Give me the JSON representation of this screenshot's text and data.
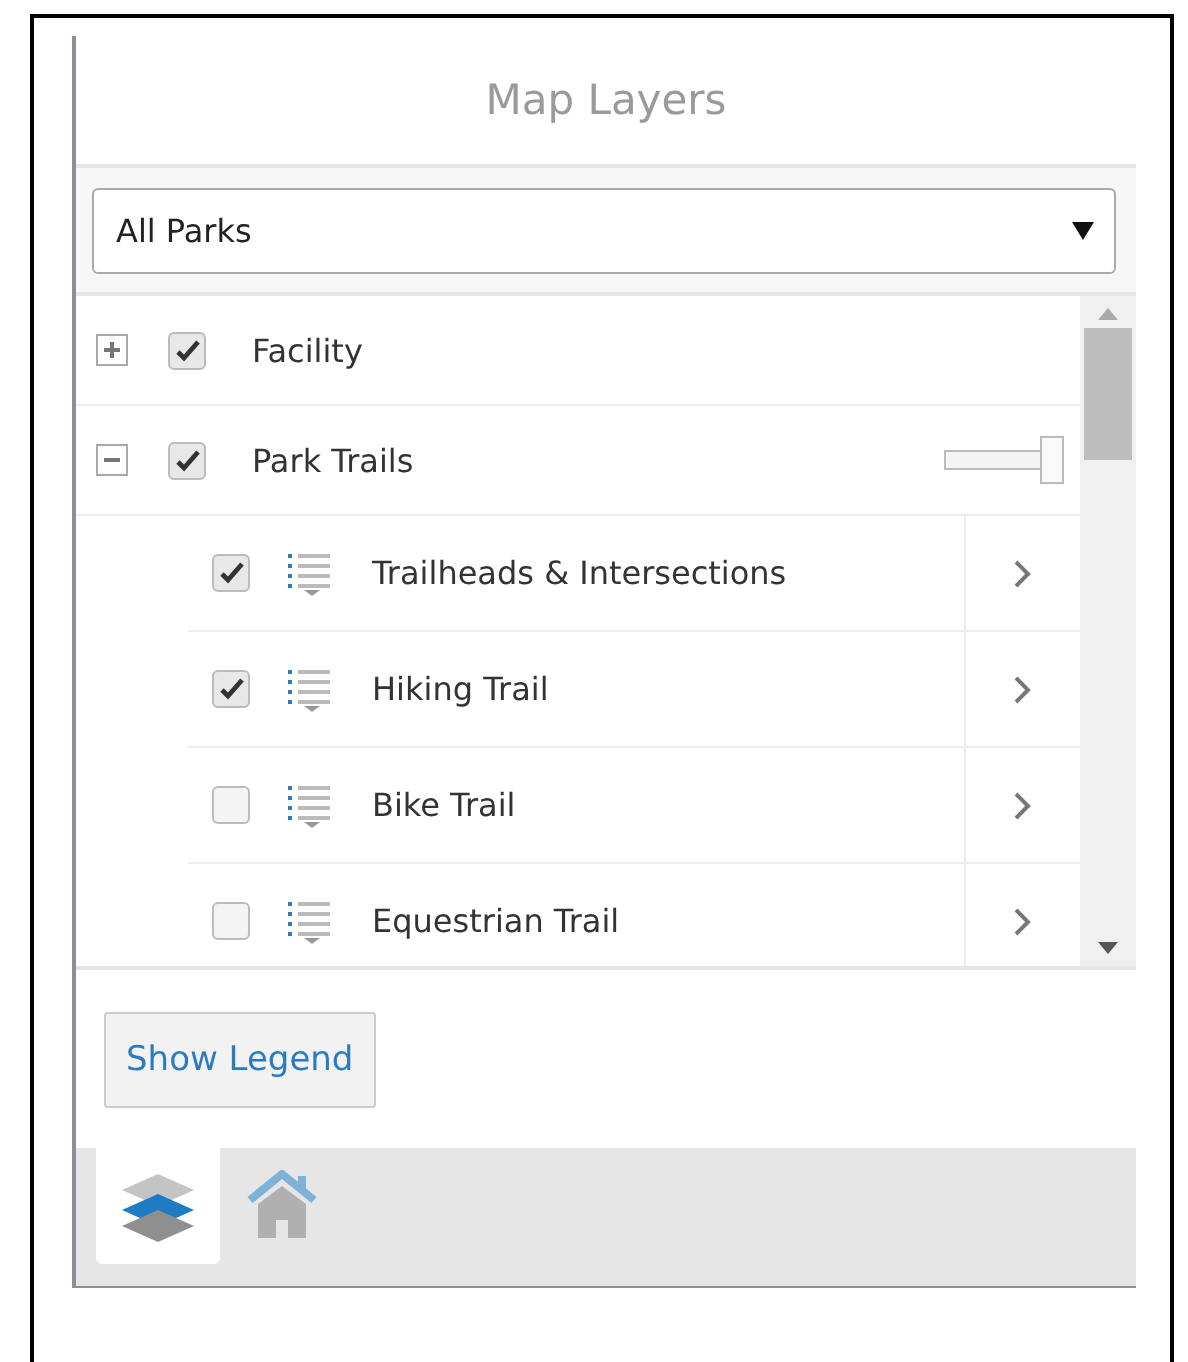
{
  "panel": {
    "title": "Map Layers"
  },
  "filter": {
    "value": "All Parks"
  },
  "layers": [
    {
      "name": "Facility",
      "expanded": false,
      "checked": true
    },
    {
      "name": "Park Trails",
      "expanded": true,
      "checked": true,
      "level": 1,
      "children": [
        {
          "name": "Trailheads & Intersections",
          "checked": true
        },
        {
          "name": "Hiking Trail",
          "checked": true
        },
        {
          "name": "Bike Trail",
          "checked": false
        },
        {
          "name": "Equestrian Trail",
          "checked": false
        }
      ]
    }
  ],
  "legend_button": {
    "label": "Show Legend"
  },
  "tabs": [
    {
      "kind": "layers",
      "selected": true
    },
    {
      "kind": "home",
      "selected": false
    }
  ]
}
